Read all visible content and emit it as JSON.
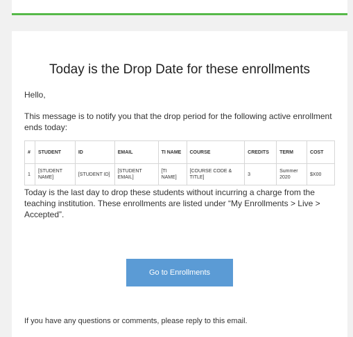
{
  "colors": {
    "background": "#f1f1f1",
    "card": "#ffffff",
    "accent_green": "#56b949",
    "button_blue": "#5b9bd5"
  },
  "email": {
    "title": "Today is the Drop Date for these enrollments",
    "greeting": "Hello,",
    "intro": "This message is to notify you that the drop period for the following active enrollment ends today:",
    "table": {
      "headers": [
        "#",
        "STUDENT",
        "ID",
        "EMAIL",
        "TI NAME",
        "COURSE",
        "CREDITS",
        "TERM",
        "COST"
      ],
      "rows": [
        [
          "1",
          "[STUDENT NAME]",
          "[STUDENT ID]",
          "[STUDENT EMAIL]",
          "[TI NAME]",
          "[COURSE CODE & TITLE]",
          "3",
          "Summer 2020",
          "$X00"
        ]
      ]
    },
    "outro": "Today is the last day to drop these students without incurring a charge from the teaching institution. These enrollments are listed under “My Enrollments > Live > Accepted”.",
    "button_label": "Go to Enrollments",
    "footer": "If you have any questions or comments, please reply to this email."
  }
}
